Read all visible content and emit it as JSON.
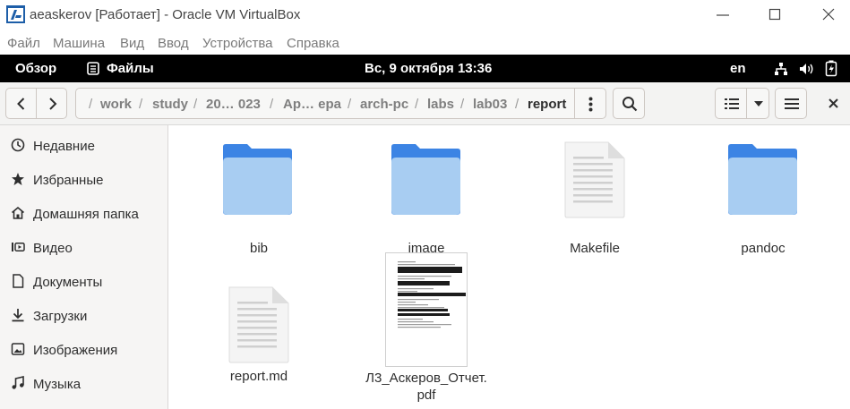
{
  "vbox": {
    "title": "aeaskerov [Работает] - Oracle VM VirtualBox",
    "menu": [
      "Файл",
      "Машина",
      "Вид",
      "Ввод",
      "Устройства",
      "Справка"
    ]
  },
  "gnome_topbar": {
    "overview": "Обзор",
    "app_name": "Файлы",
    "clock": "Вс, 9 октября  13:36",
    "input_lang": "en"
  },
  "path": {
    "crumbs": [
      "work",
      "study",
      "20… 023",
      "Ap… epa",
      "arch-pc",
      "labs",
      "lab03",
      "report"
    ]
  },
  "sidebar": {
    "items": [
      {
        "label": "Недавние",
        "icon": "clock-icon"
      },
      {
        "label": "Избранные",
        "icon": "star-icon"
      },
      {
        "label": "Домашняя папка",
        "icon": "home-icon"
      },
      {
        "label": "Видео",
        "icon": "video-icon"
      },
      {
        "label": "Документы",
        "icon": "document-icon"
      },
      {
        "label": "Загрузки",
        "icon": "download-icon"
      },
      {
        "label": "Изображения",
        "icon": "image-icon"
      },
      {
        "label": "Музыка",
        "icon": "music-icon"
      }
    ]
  },
  "files": [
    {
      "name": "bib",
      "type": "folder"
    },
    {
      "name": "image",
      "type": "folder"
    },
    {
      "name": "Makefile",
      "type": "text"
    },
    {
      "name": "pandoc",
      "type": "folder"
    },
    {
      "name": "report.md",
      "type": "text"
    },
    {
      "name_line1": "Л3_Аскеров_Отчет.",
      "name_line2": "pdf",
      "type": "pdf"
    }
  ],
  "colors": {
    "folder_top": "#3c84e4",
    "folder_body": "#a8cdf2",
    "topbar_bg": "#000000",
    "selected_crumb": "#2e2e2e"
  }
}
